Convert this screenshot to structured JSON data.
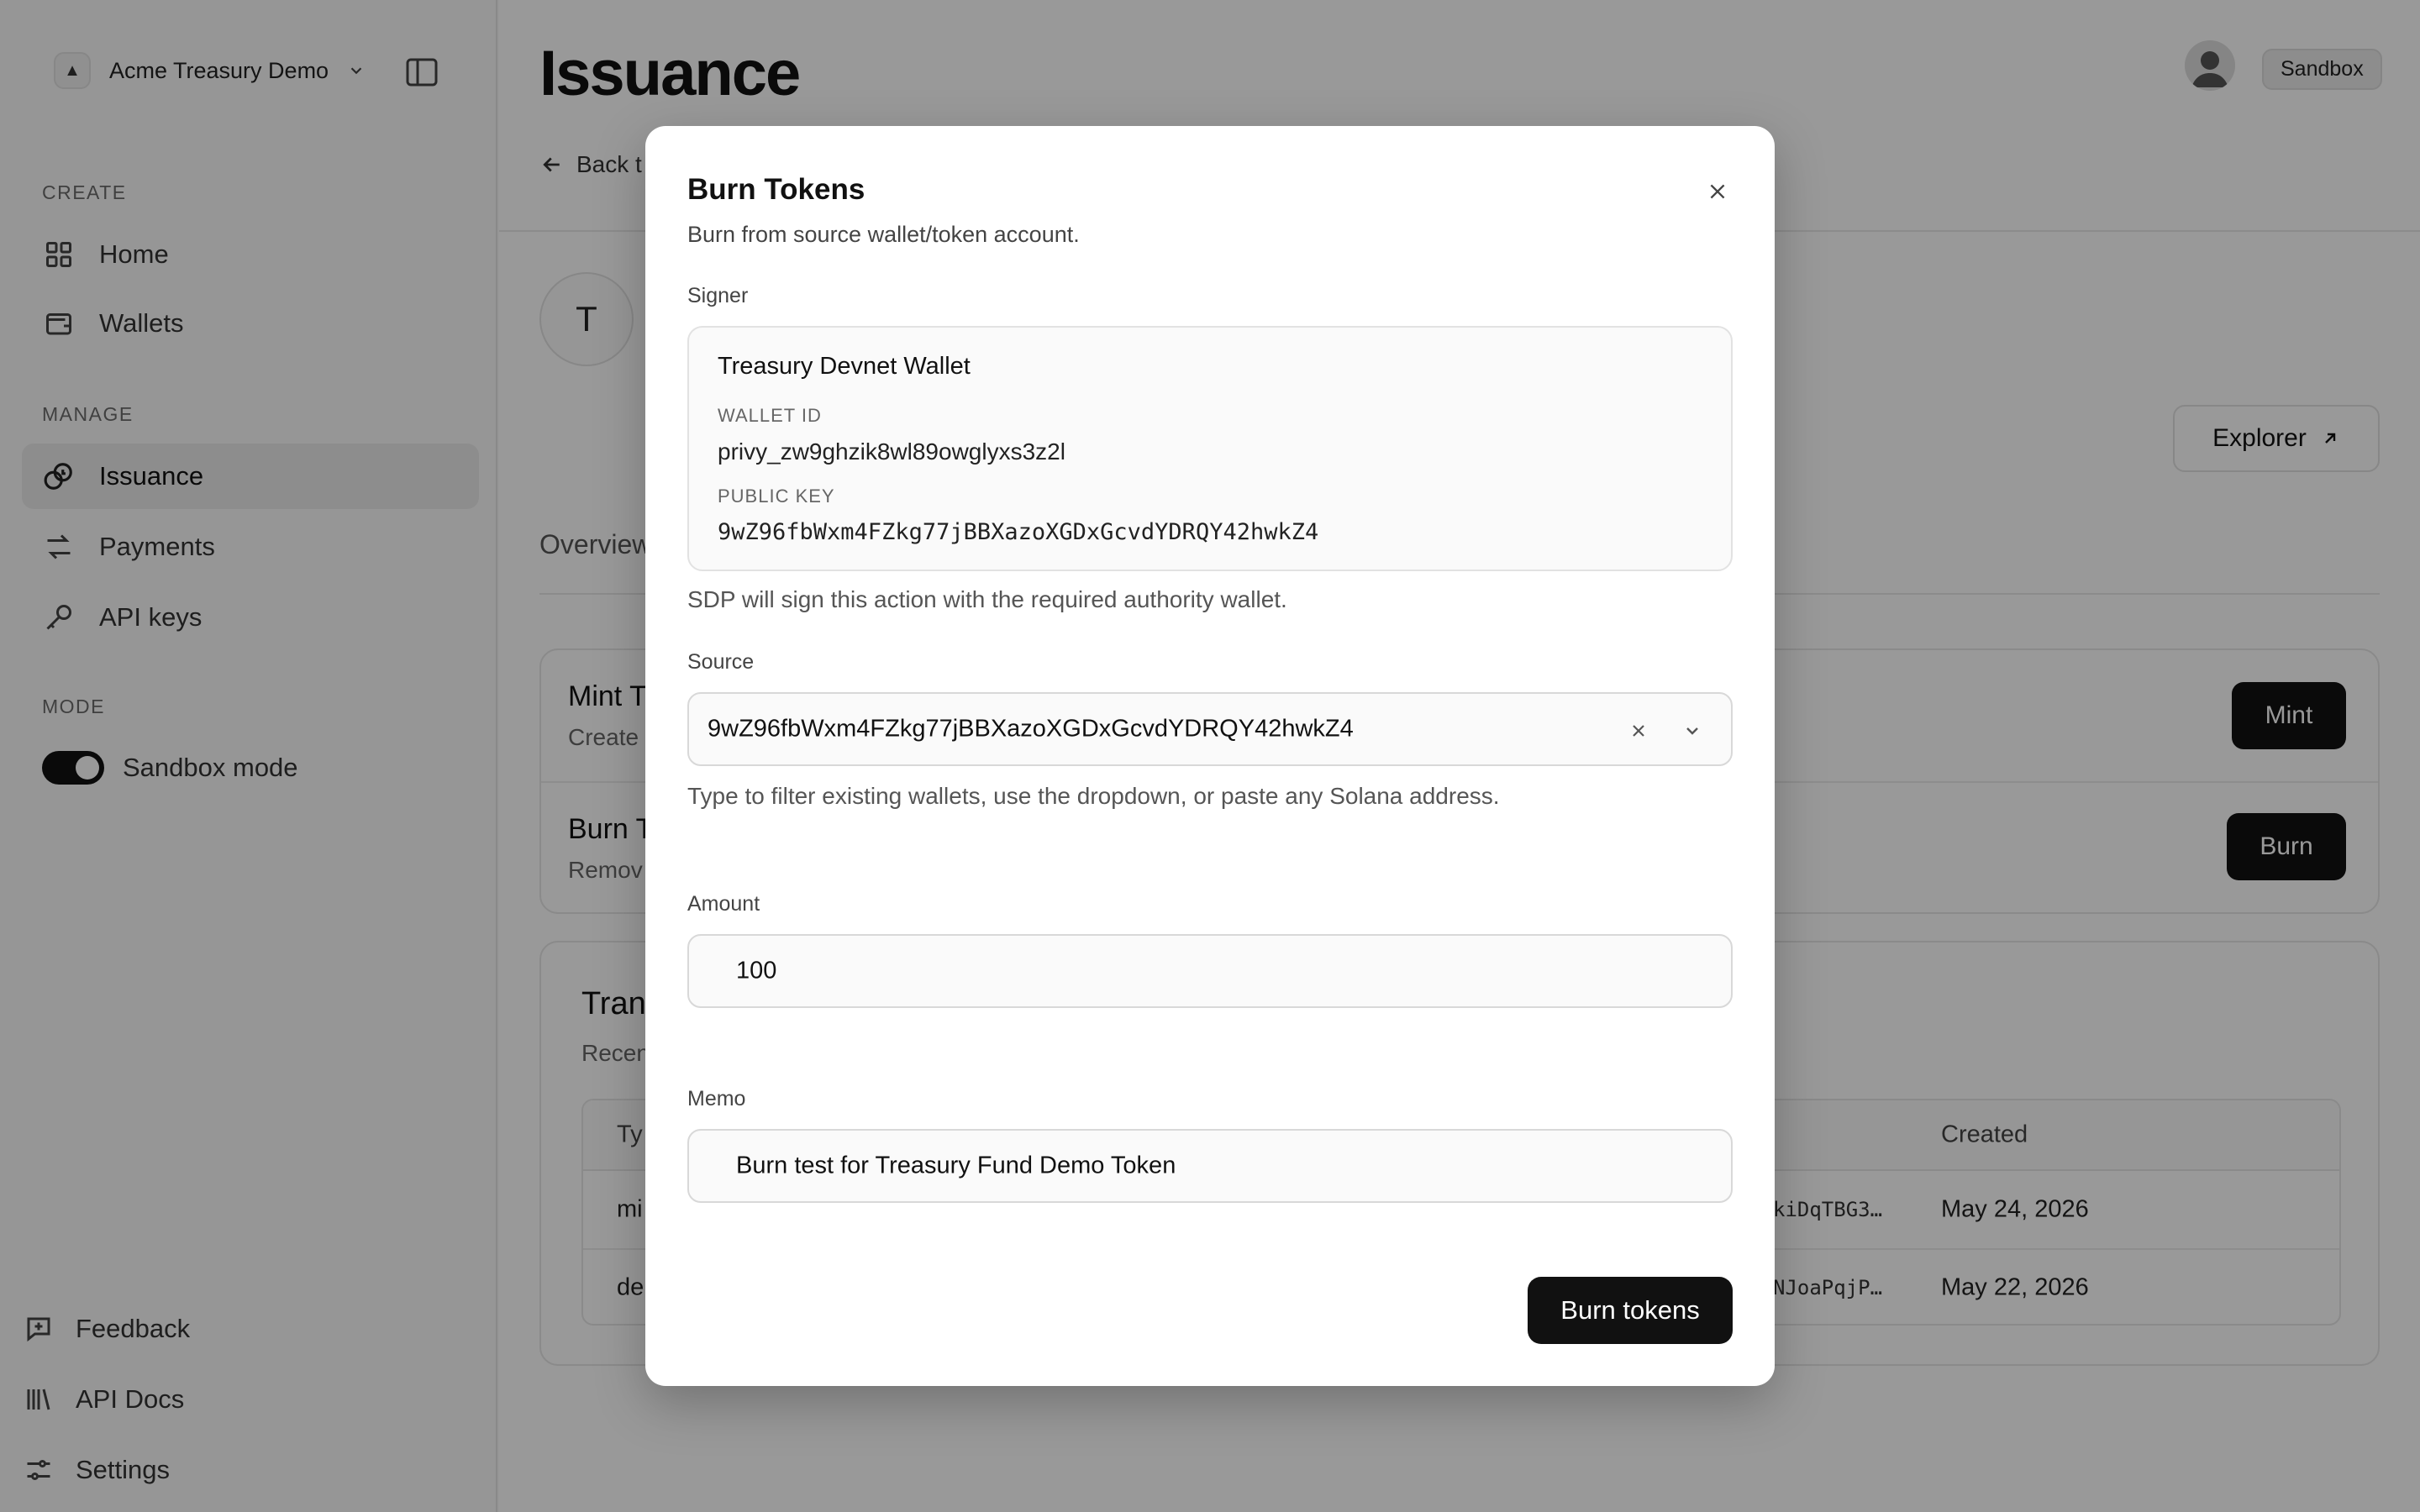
{
  "sidebar": {
    "org_name": "Acme Treasury Demo",
    "org_logo": "▲",
    "sections": {
      "create": "CREATE",
      "manage": "MANAGE",
      "mode": "MODE"
    },
    "items": [
      {
        "label": "Home",
        "icon": "grid-icon"
      },
      {
        "label": "Wallets",
        "icon": "wallet-icon"
      },
      {
        "label": "Issuance",
        "icon": "coins-icon"
      },
      {
        "label": "Payments",
        "icon": "arrows-icon"
      },
      {
        "label": "API keys",
        "icon": "key-icon"
      }
    ],
    "mode_toggle": {
      "label": "Sandbox mode",
      "on": true
    },
    "footer": [
      {
        "label": "Feedback",
        "icon": "feedback-icon"
      },
      {
        "label": "API Docs",
        "icon": "library-icon"
      },
      {
        "label": "Settings",
        "icon": "sliders-icon"
      }
    ]
  },
  "header": {
    "title": "Issuance",
    "back_label": "Back t",
    "env_badge": "Sandbox"
  },
  "token": {
    "initial": "T",
    "explorer_label": "Explorer"
  },
  "tabs": {
    "overview": "Overview"
  },
  "actions": {
    "mint": {
      "title": "Mint T",
      "desc": "Create",
      "button": "Mint"
    },
    "burn": {
      "title": "Burn T",
      "desc": "Remov",
      "button": "Burn"
    }
  },
  "transactions": {
    "title": "Tran",
    "subtitle": "Recen",
    "headers": {
      "type": "Ty",
      "created": "Created"
    },
    "rows": [
      {
        "type": "mi",
        "signature": "kiDqTBG3…",
        "created": "May 24, 2026"
      },
      {
        "type": "de",
        "signature": "NJoaPqjP…",
        "created": "May 22, 2026"
      }
    ]
  },
  "modal": {
    "title": "Burn Tokens",
    "subtitle": "Burn from source wallet/token account.",
    "signer": {
      "label": "Signer",
      "name": "Treasury Devnet Wallet",
      "wallet_id_label": "WALLET ID",
      "wallet_id": "privy_zw9ghzik8wl89owglyxs3z2l",
      "public_key_label": "PUBLIC KEY",
      "public_key": "9wZ96fbWxm4FZkg77jBBXazoXGDxGcvdYDRQY42hwkZ4",
      "helper": "SDP will sign this action with the required authority wallet."
    },
    "source": {
      "label": "Source",
      "value": "9wZ96fbWxm4FZkg77jBBXazoXGDxGcvdYDRQY42hwkZ4",
      "helper": "Type to filter existing wallets, use the dropdown, or paste any Solana address."
    },
    "amount": {
      "label": "Amount",
      "value": "100"
    },
    "memo": {
      "label": "Memo",
      "value": "Burn test for Treasury Fund Demo Token"
    },
    "submit_label": "Burn tokens"
  }
}
